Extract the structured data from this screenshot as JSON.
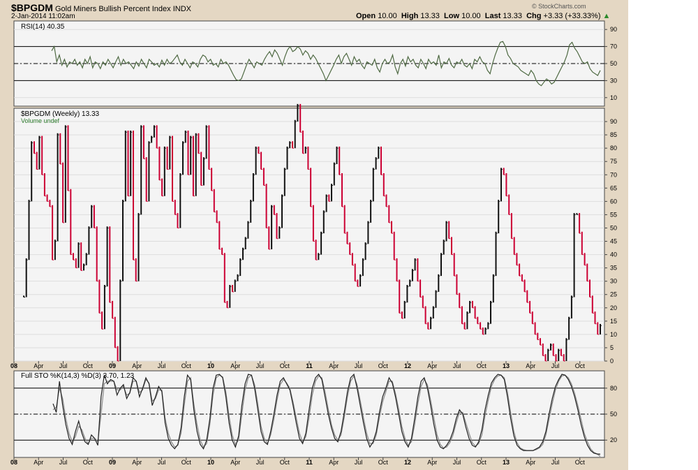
{
  "header": {
    "symbol": "$BPGDM",
    "name": "Gold Miners Bullish Percent Index",
    "exchange": "INDX",
    "date": "2-Jan-2014 11:02am",
    "watermark": "© StockCharts.com",
    "open_label": "Open",
    "open": "10.00",
    "high_label": "High",
    "high": "13.33",
    "low_label": "Low",
    "low": "10.00",
    "last_label": "Last",
    "last": "13.33",
    "chg_label": "Chg",
    "chg": "+3.33 (+33.33%)"
  },
  "colors": {
    "up": "#111111",
    "down": "#cc0033",
    "rsi": "#4f6a43",
    "stoch": "#222222",
    "frame": "#e4d7c3",
    "panel": "#f4f4f4"
  },
  "chart_data": [
    {
      "type": "line",
      "panel": "rsi",
      "title": "RSI(14) 40.35",
      "ylim": [
        0,
        100
      ],
      "yticks": [
        10,
        30,
        50,
        70,
        90
      ],
      "reference_lines": [
        30,
        50,
        70
      ],
      "x_label_positions": [
        "Apr 2008",
        "Jul 2008",
        "Oct 2008",
        "2009",
        "Apr 2009",
        "Jul 2009",
        "Oct 2009",
        "2010",
        "Apr 2010",
        "Jul 2010",
        "Oct 2010",
        "2011",
        "Apr 2011",
        "Jul 2011",
        "Oct 2011",
        "2012",
        "Apr 2012",
        "Jul 2012",
        "Oct 2012",
        "2013",
        "Apr 2013",
        "Jul 2013",
        "Oct 2013"
      ],
      "series": [
        {
          "values": [
            65,
            70,
            52,
            60,
            48,
            55,
            46,
            52,
            50,
            55,
            48,
            52,
            45,
            55,
            50,
            58,
            45,
            52,
            50,
            44,
            52,
            48,
            55,
            50,
            45,
            52,
            58,
            48,
            55,
            50,
            52,
            48,
            44,
            52,
            47,
            55,
            50,
            45,
            55,
            52,
            48,
            50,
            46,
            54,
            48,
            55,
            50,
            52,
            56,
            60,
            52,
            48,
            55,
            50,
            45,
            52,
            50,
            46,
            55,
            60,
            58,
            52,
            55,
            48,
            50,
            46,
            55,
            50,
            52,
            48,
            42,
            36,
            31,
            30,
            32,
            40,
            48,
            55,
            50,
            45,
            52,
            50,
            48,
            55,
            60,
            64,
            58,
            66,
            62,
            55,
            48,
            58,
            66,
            70,
            64,
            66,
            70,
            67,
            60,
            65,
            62,
            55,
            60,
            56,
            50,
            44,
            38,
            30,
            36,
            42,
            48,
            55,
            60,
            50,
            58,
            62,
            55,
            48,
            58,
            52,
            55,
            48,
            44,
            52,
            50,
            48,
            55,
            45,
            40,
            50,
            55,
            50,
            52,
            60,
            46,
            38,
            50,
            55,
            47,
            58,
            52,
            55,
            48,
            45,
            55,
            50,
            44,
            55,
            50,
            52,
            48,
            60,
            45,
            52,
            50,
            56,
            48,
            45,
            52,
            50,
            55,
            48,
            46,
            50,
            44,
            55,
            52,
            58,
            52,
            50,
            42,
            38,
            50,
            60,
            68,
            75,
            76,
            70,
            60,
            56,
            50,
            48,
            46,
            42,
            40,
            38,
            36,
            42,
            38,
            30,
            26,
            24,
            28,
            32,
            30,
            26,
            28,
            34,
            40,
            46,
            52,
            60,
            72,
            75,
            68,
            64,
            58,
            52,
            50,
            52,
            44,
            40,
            38,
            36,
            42
          ]
        }
      ]
    },
    {
      "type": "bar",
      "panel": "price",
      "title": "$BPGDM (Weekly) 13.33",
      "subtitle": "Volume undef",
      "ylim": [
        0,
        95
      ],
      "yticks": [
        0,
        5,
        10,
        15,
        20,
        25,
        30,
        35,
        40,
        45,
        50,
        55,
        60,
        65,
        70,
        75,
        80,
        85,
        90
      ],
      "x_labels": [
        "08",
        "Apr",
        "Jul",
        "Oct",
        "09",
        "Apr",
        "Jul",
        "Oct",
        "10",
        "Apr",
        "Jul",
        "Oct",
        "11",
        "Apr",
        "Jul",
        "Oct",
        "12",
        "Apr",
        "Jul",
        "Oct",
        "13",
        "Apr",
        "Jul",
        "Oct"
      ],
      "series": [
        {
          "values": [
            24,
            38,
            60,
            82,
            78,
            72,
            84,
            70,
            62,
            60,
            58,
            38,
            45,
            85,
            74,
            52,
            88,
            64,
            40,
            38,
            35,
            44,
            34,
            36,
            40,
            50,
            58,
            50,
            30,
            18,
            12,
            28,
            50,
            22,
            16,
            5,
            0,
            30,
            60,
            86,
            62,
            86,
            38,
            30,
            55,
            88,
            76,
            60,
            82,
            84,
            88,
            80,
            68,
            62,
            80,
            72,
            84,
            60,
            55,
            50,
            70,
            82,
            86,
            70,
            84,
            62,
            85,
            78,
            66,
            76,
            88,
            72,
            64,
            56,
            52,
            42,
            40,
            22,
            20,
            28,
            26,
            30,
            32,
            38,
            42,
            46,
            52,
            60,
            70,
            80,
            78,
            72,
            66,
            50,
            42,
            58,
            55,
            46,
            50,
            62,
            72,
            80,
            82,
            80,
            90,
            96,
            86,
            78,
            80,
            72,
            58,
            45,
            38,
            40,
            48,
            56,
            62,
            60,
            66,
            74,
            80,
            70,
            58,
            48,
            44,
            40,
            36,
            30,
            28,
            32,
            38,
            44,
            52,
            60,
            72,
            76,
            80,
            70,
            62,
            58,
            52,
            48,
            38,
            30,
            18,
            16,
            22,
            28,
            30,
            34,
            38,
            30,
            24,
            20,
            14,
            12,
            16,
            20,
            26,
            32,
            40,
            45,
            52,
            46,
            40,
            32,
            25,
            20,
            14,
            12,
            18,
            22,
            20,
            16,
            14,
            12,
            10,
            12,
            14,
            22,
            32,
            48,
            60,
            72,
            70,
            62,
            55,
            46,
            40,
            36,
            32,
            30,
            26,
            22,
            18,
            14,
            10,
            8,
            6,
            2,
            0,
            4,
            6,
            2,
            0,
            4,
            2,
            0,
            8,
            16,
            24,
            55,
            55,
            48,
            40,
            36,
            30,
            24,
            18,
            14,
            10,
            13.33
          ]
        }
      ]
    },
    {
      "type": "line",
      "panel": "stochastic",
      "title": "Full STO %K(14,3) %D(3) 3.70, 1.23",
      "ylim": [
        0,
        100
      ],
      "yticks": [
        20,
        50,
        80
      ],
      "reference_lines": [
        20,
        50,
        80
      ],
      "series": [
        {
          "name": "%K",
          "values": [
            62,
            52,
            88,
            60,
            38,
            22,
            15,
            30,
            42,
            28,
            18,
            15,
            26,
            22,
            14,
            70,
            95,
            85,
            90,
            88,
            72,
            80,
            84,
            68,
            75,
            92,
            88,
            70,
            80,
            92,
            85,
            60,
            70,
            82,
            76,
            40,
            22,
            14,
            10,
            15,
            34,
            70,
            95,
            90,
            55,
            30,
            15,
            10,
            20,
            45,
            80,
            95,
            96,
            92,
            70,
            40,
            20,
            12,
            25,
            60,
            85,
            96,
            95,
            80,
            55,
            30,
            18,
            15,
            30,
            50,
            72,
            88,
            92,
            85,
            78,
            60,
            40,
            22,
            16,
            28,
            55,
            80,
            92,
            96,
            90,
            70,
            50,
            34,
            22,
            18,
            30,
            52,
            76,
            92,
            96,
            80,
            60,
            40,
            22,
            12,
            18,
            30,
            52,
            70,
            80,
            92,
            86,
            70,
            50,
            30,
            18,
            12,
            22,
            45,
            70,
            88,
            92,
            80,
            60,
            38,
            20,
            12,
            10,
            14,
            20,
            30,
            45,
            55,
            50,
            35,
            22,
            14,
            12,
            18,
            32,
            55,
            72,
            86,
            92,
            96,
            95,
            90,
            70,
            45,
            25,
            14,
            10,
            8,
            8,
            8,
            8,
            10,
            12,
            18,
            30,
            50,
            68,
            82,
            90,
            96,
            95,
            90,
            82,
            70,
            55,
            38,
            24,
            14,
            8,
            5,
            4,
            3.7
          ]
        },
        {
          "name": "%D",
          "values": [
            55,
            58,
            80,
            68,
            45,
            28,
            18,
            24,
            36,
            32,
            22,
            16,
            22,
            22,
            18,
            50,
            85,
            88,
            88,
            88,
            78,
            78,
            82,
            72,
            74,
            88,
            88,
            75,
            78,
            90,
            86,
            65,
            68,
            78,
            78,
            46,
            28,
            18,
            12,
            14,
            28,
            60,
            88,
            92,
            62,
            38,
            20,
            12,
            16,
            38,
            72,
            92,
            95,
            93,
            76,
            48,
            26,
            15,
            20,
            50,
            78,
            92,
            95,
            84,
            62,
            36,
            22,
            16,
            26,
            44,
            66,
            84,
            90,
            86,
            80,
            64,
            46,
            28,
            18,
            24,
            46,
            72,
            88,
            94,
            92,
            76,
            56,
            38,
            26,
            20,
            26,
            46,
            70,
            88,
            94,
            84,
            66,
            46,
            28,
            16,
            16,
            26,
            46,
            64,
            76,
            88,
            88,
            74,
            56,
            36,
            22,
            14,
            18,
            38,
            62,
            82,
            90,
            84,
            66,
            46,
            26,
            15,
            11,
            12,
            17,
            26,
            40,
            52,
            52,
            40,
            28,
            17,
            13,
            16,
            26,
            48,
            66,
            82,
            90,
            94,
            95,
            92,
            76,
            52,
            30,
            17,
            11,
            9,
            8,
            8,
            8,
            9,
            11,
            15,
            26,
            44,
            62,
            78,
            88,
            94,
            95,
            92,
            85,
            74,
            60,
            44,
            28,
            18,
            10,
            6,
            4,
            1.23
          ]
        }
      ]
    }
  ]
}
